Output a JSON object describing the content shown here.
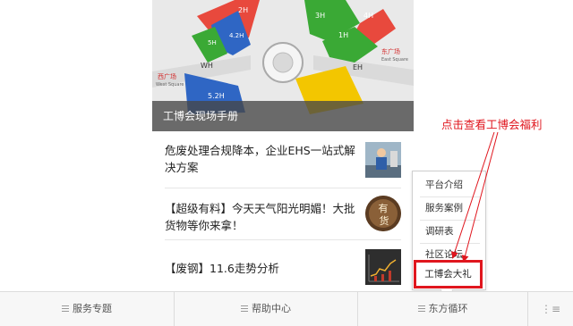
{
  "hero": {
    "caption": "工博会现场手册",
    "map_labels": {
      "hall_2h": "2H",
      "hall_3h": "3H",
      "hall_4h": "4H",
      "hall_5h": "5H",
      "hall_1h": "1H",
      "hall_42h": "4.2H",
      "hall_52h": "5.2H",
      "hall_wh": "WH",
      "hall_eh": "EH",
      "west_square_cn": "西广场",
      "west_square_en": "West Square",
      "east_square_cn": "东广场",
      "east_square_en": "East Square"
    }
  },
  "articles": [
    {
      "title": "危废处理合规降本，企业EHS一站式解决方案",
      "thumb_icon": "worker-photo"
    },
    {
      "title": "【超级有料】今天天气阳光明媚！大批货物等你来拿！",
      "thumb_icon": "you-huo-badge",
      "thumb_text": "有货"
    },
    {
      "title": "【废钢】11.6走势分析",
      "thumb_icon": "price-chart-photo"
    }
  ],
  "popup_menu": {
    "items": [
      "平台介绍",
      "服务案例",
      "调研表",
      "社区论坛"
    ],
    "highlighted_item": "工博会大礼"
  },
  "annotation": {
    "text": "点击查看工博会福利",
    "color": "#e0161e"
  },
  "bottom_nav": {
    "items": [
      "服务专题",
      "帮助中心",
      "东方循环"
    ],
    "menu_icon": "keyboard-toggle-icon"
  },
  "colors": {
    "accent_red": "#e0161e",
    "map_red": "#e8493d",
    "map_green": "#3aa935",
    "map_blue": "#2f66c4",
    "map_yellow": "#f3c600"
  }
}
